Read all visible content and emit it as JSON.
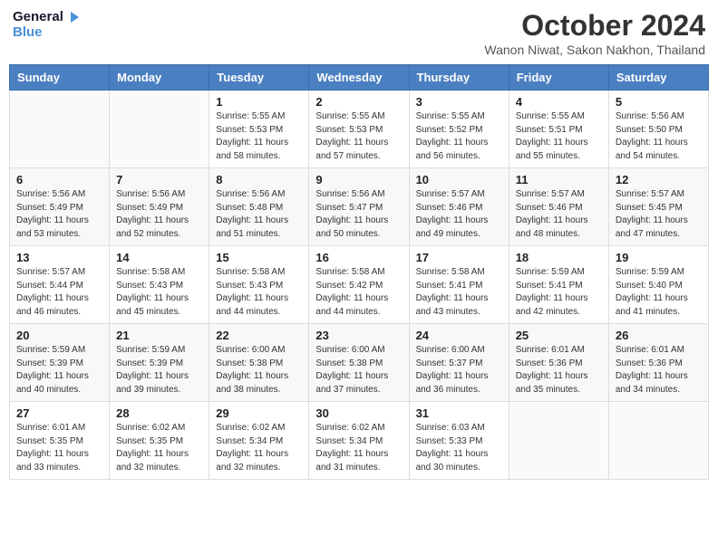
{
  "header": {
    "logo_line1": "General",
    "logo_line2": "Blue",
    "month_title": "October 2024",
    "location": "Wanon Niwat, Sakon Nakhon, Thailand"
  },
  "weekdays": [
    "Sunday",
    "Monday",
    "Tuesday",
    "Wednesday",
    "Thursday",
    "Friday",
    "Saturday"
  ],
  "weeks": [
    [
      {
        "day": "",
        "info": ""
      },
      {
        "day": "",
        "info": ""
      },
      {
        "day": "1",
        "info": "Sunrise: 5:55 AM\nSunset: 5:53 PM\nDaylight: 11 hours\nand 58 minutes."
      },
      {
        "day": "2",
        "info": "Sunrise: 5:55 AM\nSunset: 5:53 PM\nDaylight: 11 hours\nand 57 minutes."
      },
      {
        "day": "3",
        "info": "Sunrise: 5:55 AM\nSunset: 5:52 PM\nDaylight: 11 hours\nand 56 minutes."
      },
      {
        "day": "4",
        "info": "Sunrise: 5:55 AM\nSunset: 5:51 PM\nDaylight: 11 hours\nand 55 minutes."
      },
      {
        "day": "5",
        "info": "Sunrise: 5:56 AM\nSunset: 5:50 PM\nDaylight: 11 hours\nand 54 minutes."
      }
    ],
    [
      {
        "day": "6",
        "info": "Sunrise: 5:56 AM\nSunset: 5:49 PM\nDaylight: 11 hours\nand 53 minutes."
      },
      {
        "day": "7",
        "info": "Sunrise: 5:56 AM\nSunset: 5:49 PM\nDaylight: 11 hours\nand 52 minutes."
      },
      {
        "day": "8",
        "info": "Sunrise: 5:56 AM\nSunset: 5:48 PM\nDaylight: 11 hours\nand 51 minutes."
      },
      {
        "day": "9",
        "info": "Sunrise: 5:56 AM\nSunset: 5:47 PM\nDaylight: 11 hours\nand 50 minutes."
      },
      {
        "day": "10",
        "info": "Sunrise: 5:57 AM\nSunset: 5:46 PM\nDaylight: 11 hours\nand 49 minutes."
      },
      {
        "day": "11",
        "info": "Sunrise: 5:57 AM\nSunset: 5:46 PM\nDaylight: 11 hours\nand 48 minutes."
      },
      {
        "day": "12",
        "info": "Sunrise: 5:57 AM\nSunset: 5:45 PM\nDaylight: 11 hours\nand 47 minutes."
      }
    ],
    [
      {
        "day": "13",
        "info": "Sunrise: 5:57 AM\nSunset: 5:44 PM\nDaylight: 11 hours\nand 46 minutes."
      },
      {
        "day": "14",
        "info": "Sunrise: 5:58 AM\nSunset: 5:43 PM\nDaylight: 11 hours\nand 45 minutes."
      },
      {
        "day": "15",
        "info": "Sunrise: 5:58 AM\nSunset: 5:43 PM\nDaylight: 11 hours\nand 44 minutes."
      },
      {
        "day": "16",
        "info": "Sunrise: 5:58 AM\nSunset: 5:42 PM\nDaylight: 11 hours\nand 44 minutes."
      },
      {
        "day": "17",
        "info": "Sunrise: 5:58 AM\nSunset: 5:41 PM\nDaylight: 11 hours\nand 43 minutes."
      },
      {
        "day": "18",
        "info": "Sunrise: 5:59 AM\nSunset: 5:41 PM\nDaylight: 11 hours\nand 42 minutes."
      },
      {
        "day": "19",
        "info": "Sunrise: 5:59 AM\nSunset: 5:40 PM\nDaylight: 11 hours\nand 41 minutes."
      }
    ],
    [
      {
        "day": "20",
        "info": "Sunrise: 5:59 AM\nSunset: 5:39 PM\nDaylight: 11 hours\nand 40 minutes."
      },
      {
        "day": "21",
        "info": "Sunrise: 5:59 AM\nSunset: 5:39 PM\nDaylight: 11 hours\nand 39 minutes."
      },
      {
        "day": "22",
        "info": "Sunrise: 6:00 AM\nSunset: 5:38 PM\nDaylight: 11 hours\nand 38 minutes."
      },
      {
        "day": "23",
        "info": "Sunrise: 6:00 AM\nSunset: 5:38 PM\nDaylight: 11 hours\nand 37 minutes."
      },
      {
        "day": "24",
        "info": "Sunrise: 6:00 AM\nSunset: 5:37 PM\nDaylight: 11 hours\nand 36 minutes."
      },
      {
        "day": "25",
        "info": "Sunrise: 6:01 AM\nSunset: 5:36 PM\nDaylight: 11 hours\nand 35 minutes."
      },
      {
        "day": "26",
        "info": "Sunrise: 6:01 AM\nSunset: 5:36 PM\nDaylight: 11 hours\nand 34 minutes."
      }
    ],
    [
      {
        "day": "27",
        "info": "Sunrise: 6:01 AM\nSunset: 5:35 PM\nDaylight: 11 hours\nand 33 minutes."
      },
      {
        "day": "28",
        "info": "Sunrise: 6:02 AM\nSunset: 5:35 PM\nDaylight: 11 hours\nand 32 minutes."
      },
      {
        "day": "29",
        "info": "Sunrise: 6:02 AM\nSunset: 5:34 PM\nDaylight: 11 hours\nand 32 minutes."
      },
      {
        "day": "30",
        "info": "Sunrise: 6:02 AM\nSunset: 5:34 PM\nDaylight: 11 hours\nand 31 minutes."
      },
      {
        "day": "31",
        "info": "Sunrise: 6:03 AM\nSunset: 5:33 PM\nDaylight: 11 hours\nand 30 minutes."
      },
      {
        "day": "",
        "info": ""
      },
      {
        "day": "",
        "info": ""
      }
    ]
  ]
}
